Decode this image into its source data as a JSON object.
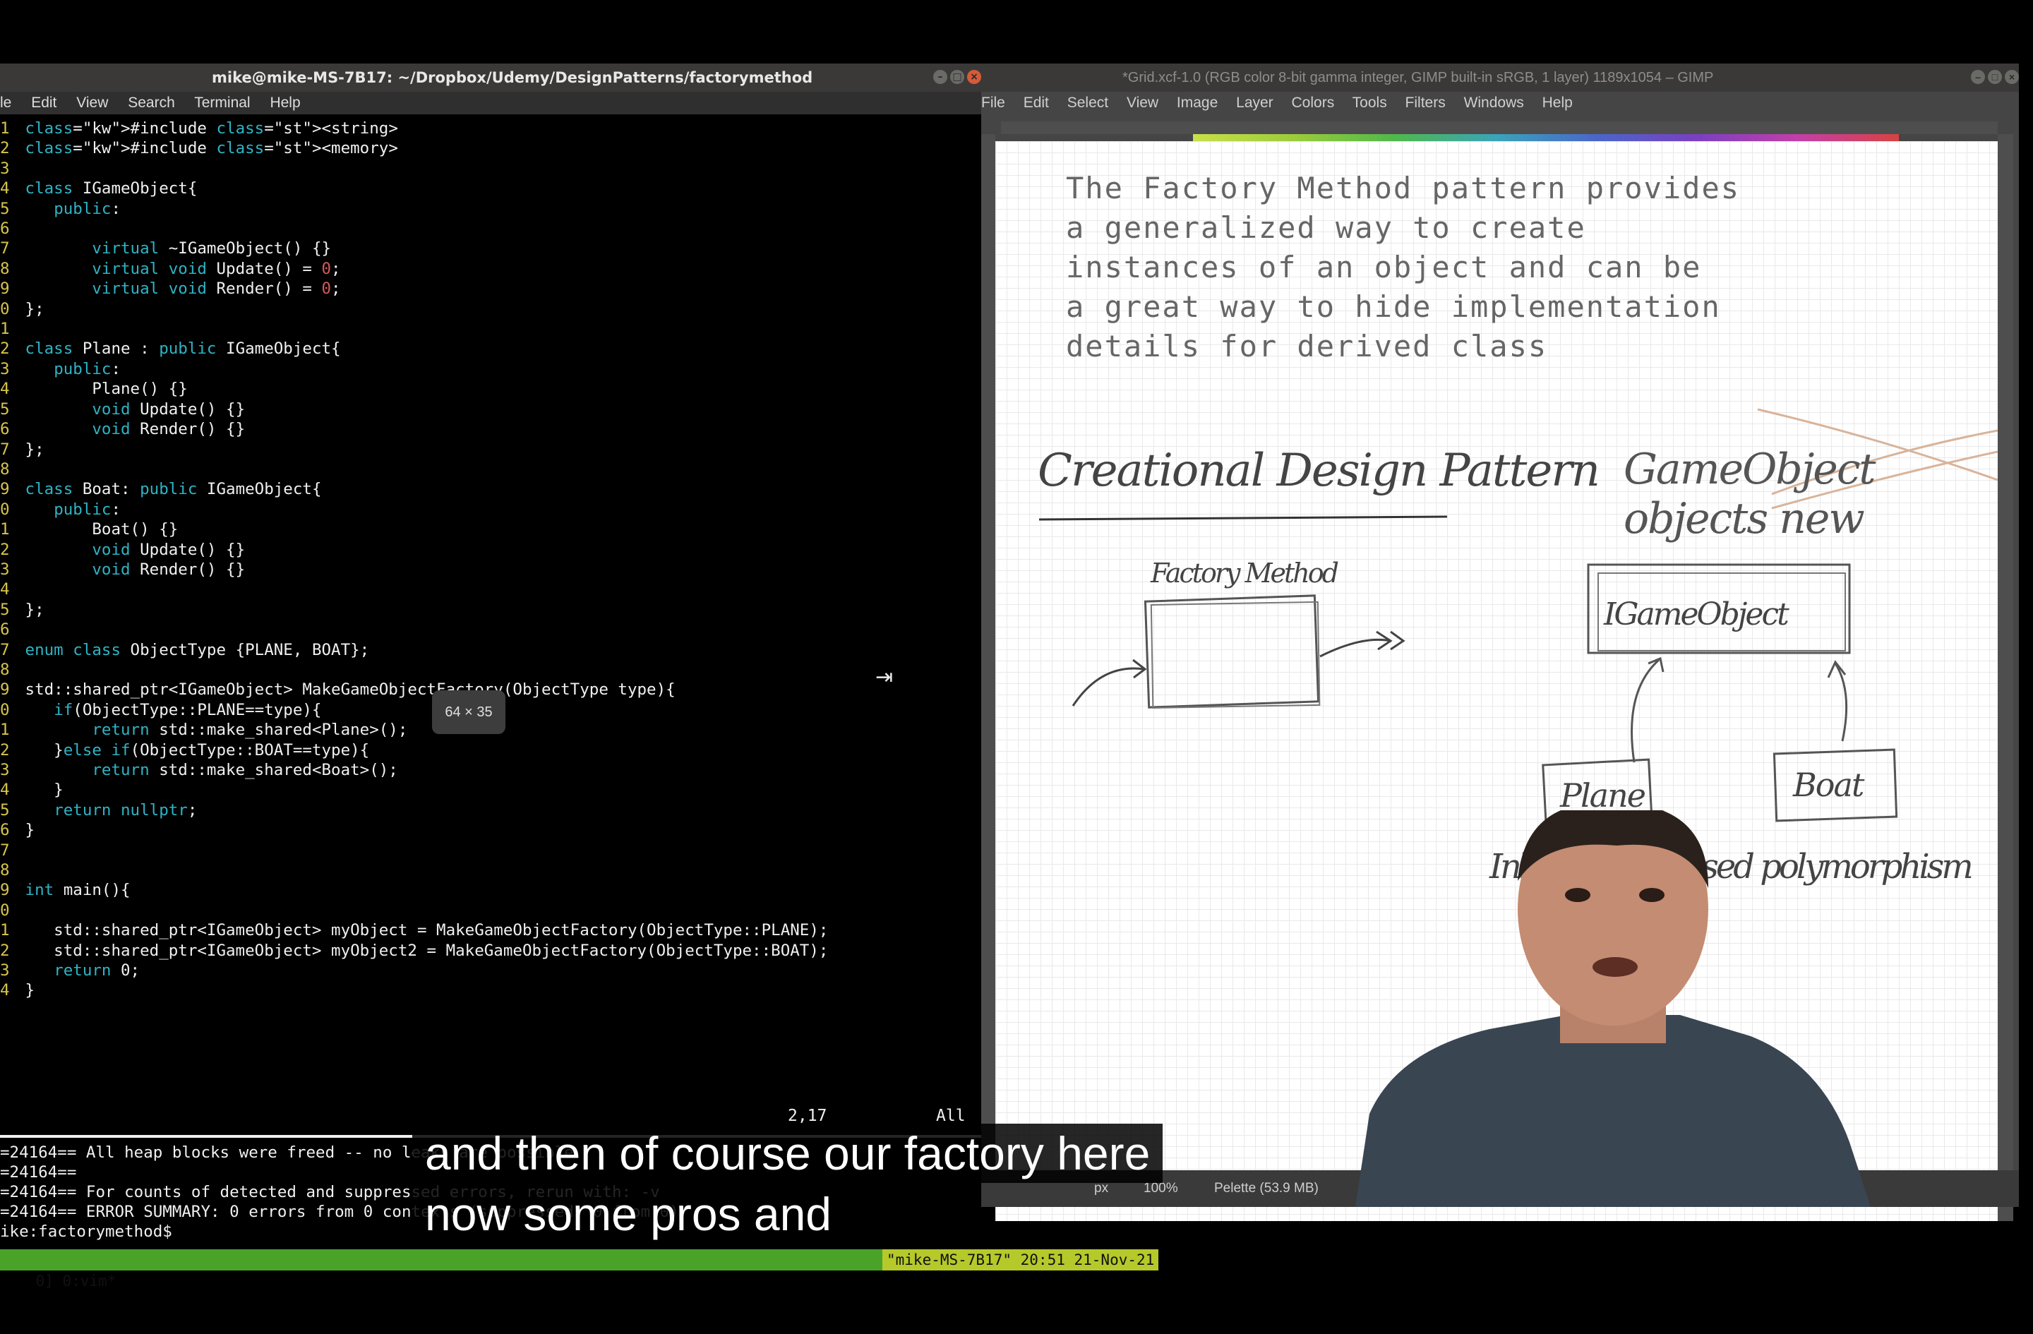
{
  "terminal": {
    "title": "mike@mike-MS-7B17: ~/Dropbox/Udemy/DesignPatterns/factorymethod",
    "menu": [
      "le",
      "Edit",
      "View",
      "Search",
      "Terminal",
      "Help"
    ],
    "code_lines": [
      {
        "n": "1",
        "text": "#include <string>"
      },
      {
        "n": "2",
        "text": "#include <memory>"
      },
      {
        "n": "3",
        "text": ""
      },
      {
        "n": "4",
        "text": "class IGameObject{"
      },
      {
        "n": "5",
        "text": "    public:"
      },
      {
        "n": "6",
        "text": ""
      },
      {
        "n": "7",
        "text": "        virtual ~IGameObject() {}"
      },
      {
        "n": "8",
        "text": "        virtual void Update() = 0;"
      },
      {
        "n": "9",
        "text": "        virtual void Render() = 0;"
      },
      {
        "n": "10",
        "text": "};"
      },
      {
        "n": "11",
        "text": ""
      },
      {
        "n": "12",
        "text": "class Plane : public IGameObject{"
      },
      {
        "n": "13",
        "text": "    public:"
      },
      {
        "n": "14",
        "text": "        Plane() {}"
      },
      {
        "n": "15",
        "text": "        void Update() {}"
      },
      {
        "n": "16",
        "text": "        void Render() {}"
      },
      {
        "n": "17",
        "text": "};"
      },
      {
        "n": "18",
        "text": ""
      },
      {
        "n": "19",
        "text": "class Boat: public IGameObject{"
      },
      {
        "n": "20",
        "text": "    public:"
      },
      {
        "n": "21",
        "text": "        Boat() {}"
      },
      {
        "n": "22",
        "text": "        void Update() {}"
      },
      {
        "n": "23",
        "text": "        void Render() {}"
      },
      {
        "n": "24",
        "text": ""
      },
      {
        "n": "25",
        "text": "};"
      },
      {
        "n": "26",
        "text": ""
      },
      {
        "n": "27",
        "text": "enum class ObjectType {PLANE, BOAT};"
      },
      {
        "n": "28",
        "text": ""
      },
      {
        "n": "29",
        "text": "std::shared_ptr<IGameObject> MakeGameObjectFactory(ObjectType type){"
      },
      {
        "n": "30",
        "text": "    if(ObjectType::PLANE==type){"
      },
      {
        "n": "31",
        "text": "        return std::make_shared<Plane>();"
      },
      {
        "n": "32",
        "text": "    }else if(ObjectType::BOAT==type){"
      },
      {
        "n": "33",
        "text": "        return std::make_shared<Boat>();"
      },
      {
        "n": "34",
        "text": "    }"
      },
      {
        "n": "35",
        "text": "    return nullptr;"
      },
      {
        "n": "36",
        "text": "}"
      },
      {
        "n": "37",
        "text": ""
      },
      {
        "n": "38",
        "text": ""
      },
      {
        "n": "39",
        "text": "int main(){"
      },
      {
        "n": "40",
        "text": ""
      },
      {
        "n": "41",
        "text": "    std::shared_ptr<IGameObject> myObject = MakeGameObjectFactory(ObjectType::PLANE);"
      },
      {
        "n": "42",
        "text": "    std::shared_ptr<IGameObject> myObject2 = MakeGameObjectFactory(ObjectType::BOAT);"
      },
      {
        "n": "43",
        "text": "    return 0;"
      },
      {
        "n": "44",
        "text": "}"
      }
    ],
    "status_position": "2,17",
    "status_scope": "All",
    "size_tooltip": "64 × 35",
    "shell_lines": [
      "=24164== All heap blocks were freed -- no leaks are possible",
      "=24164==",
      "=24164== For counts of detected and suppressed errors, rerun with: -v",
      "=24164== ERROR SUMMARY: 0 errors from 0 contexts (suppressed: 0 from 0)",
      "ike:factorymethod$"
    ],
    "tmux_left": "0] 0:vim*",
    "tmux_right": "\"mike-MS-7B17\" 20:51 21-Nov-21"
  },
  "gimp": {
    "title": "*Grid.xcf-1.0 (RGB color 8-bit gamma integer, GIMP built-in sRGB, 1 layer) 1189x1054 – GIMP",
    "menu": [
      "File",
      "Edit",
      "Select",
      "View",
      "Image",
      "Layer",
      "Colors",
      "Tools",
      "Filters",
      "Windows",
      "Help"
    ],
    "canvas_text": [
      "The Factory Method pattern provides",
      "a generalized way to create",
      "instances of an object and can be",
      "a great way to hide implementation",
      "details for derived class"
    ],
    "handwriting": {
      "heading": "Creational Design Pattern",
      "crossed": "GameObject objects new",
      "factory": "Factory Method",
      "base": "IGameObject",
      "plane": "Plane",
      "boat": "Boat",
      "inheritance": "Inheritance based polymorphism"
    },
    "status_unit": "px",
    "status_zoom": "100%",
    "status_info": "Pelette (53.9 MB)"
  },
  "subtitles": {
    "line1": "and then of course our factory here",
    "line2": "now some pros and"
  },
  "colors": {
    "terminal_bg": "#000000",
    "linenumber": "#d6c44c",
    "keyword": "#2fb3c4",
    "literal": "#d45a5a",
    "tmux_bar": "#4aa329",
    "gimp_bg": "#454545",
    "sketch_crossout": "#d8b49a"
  },
  "icons": [
    "minimize-icon",
    "maximize-icon",
    "close-icon",
    "tab-arrow-icon"
  ]
}
